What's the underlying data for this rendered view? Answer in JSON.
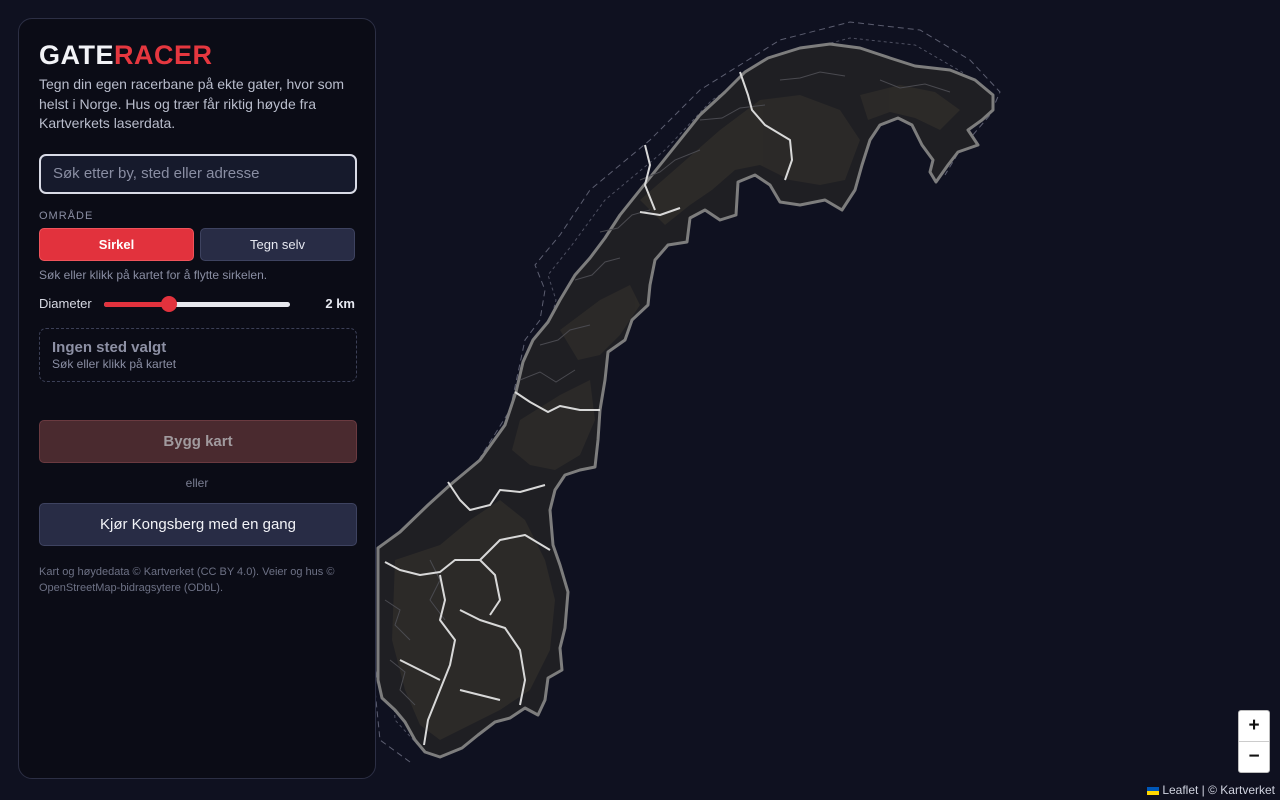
{
  "app": {
    "logo_part1": "GATE",
    "logo_part2": "RACER",
    "intro": "Tegn din egen racerbane på ekte gater, hvor som helst i Norge. Hus og trær får riktig høyde fra Kartverkets laserdata."
  },
  "search": {
    "placeholder": "Søk etter by, sted eller adresse",
    "value": ""
  },
  "area": {
    "label": "OMRÅDE",
    "options": [
      {
        "label": "Sirkel",
        "active": true
      },
      {
        "label": "Tegn selv",
        "active": false
      }
    ],
    "hint": "Søk eller klikk på kartet for å flytte sirkelen."
  },
  "diameter": {
    "label": "Diameter",
    "value_text": "2 km",
    "slider_fraction": 0.35
  },
  "selection": {
    "title": "Ingen sted valgt",
    "subtitle": "Søk eller klikk på kartet"
  },
  "actions": {
    "build_label": "Bygg kart",
    "or_label": "eller",
    "drive_label": "Kjør Kongsberg med en gang"
  },
  "credits": "Kart og høydedata © Kartverket (CC BY 4.0). Veier og hus © OpenStreetMap-bidragsytere (ODbL).",
  "map": {
    "zoom_in": "+",
    "zoom_out": "−",
    "attribution_leaflet": "Leaflet",
    "attribution_rest": " | © Kartverket",
    "colors": {
      "background": "#0f1120",
      "land": "#1f1f23",
      "terrain": "#2d2b29",
      "border": "#7d7d7d",
      "roads": "#d8d8d8"
    }
  },
  "colors": {
    "accent": "#e2323d",
    "panel": "#0b0c16",
    "button": "#282c45"
  }
}
